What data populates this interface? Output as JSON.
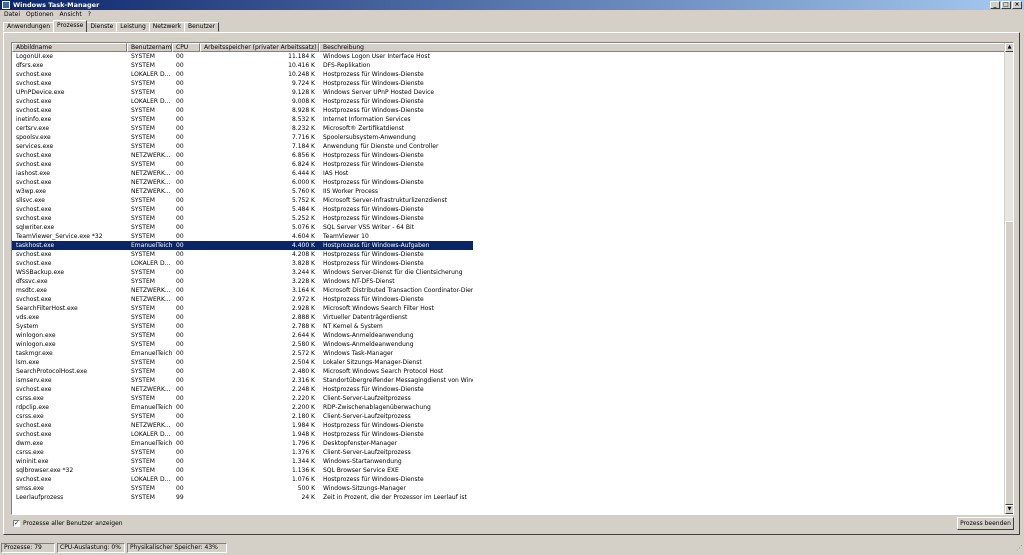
{
  "window": {
    "title": "Windows Task-Manager"
  },
  "menu": [
    "Datei",
    "Optionen",
    "Ansicht",
    "?"
  ],
  "tabs": [
    "Anwendungen",
    "Prozesse",
    "Dienste",
    "Leistung",
    "Netzwerk",
    "Benutzer"
  ],
  "active_tab": "Prozesse",
  "columns": {
    "name": "Abbildname",
    "user": "Benutzername",
    "cpu": "CPU",
    "mem": "Arbeitsspeicher (privater Arbeitssatz)",
    "desc": "Beschreibung"
  },
  "processes": [
    [
      "LogonUI.exe",
      "SYSTEM",
      "00",
      "11.184 K",
      "Windows Logon User Interface Host"
    ],
    [
      "dfsrs.exe",
      "SYSTEM",
      "00",
      "10.416 K",
      "DFS-Replikation"
    ],
    [
      "svchost.exe",
      "LOKALER D...",
      "00",
      "10.248 K",
      "Hostprozess für Windows-Dienste"
    ],
    [
      "svchost.exe",
      "SYSTEM",
      "00",
      "9.724 K",
      "Hostprozess für Windows-Dienste"
    ],
    [
      "UPnPDevice.exe",
      "SYSTEM",
      "00",
      "9.128 K",
      "Windows Server UPnP Hosted Device"
    ],
    [
      "svchost.exe",
      "LOKALER D...",
      "00",
      "9.008 K",
      "Hostprozess für Windows-Dienste"
    ],
    [
      "svchost.exe",
      "SYSTEM",
      "00",
      "8.928 K",
      "Hostprozess für Windows-Dienste"
    ],
    [
      "inetinfo.exe",
      "SYSTEM",
      "00",
      "8.532 K",
      "Internet Information Services"
    ],
    [
      "certsrv.exe",
      "SYSTEM",
      "00",
      "8.232 K",
      "Microsoft® Zertifikatdienst"
    ],
    [
      "spoolsv.exe",
      "SYSTEM",
      "00",
      "7.716 K",
      "Spoolersubsystem-Anwendung"
    ],
    [
      "services.exe",
      "SYSTEM",
      "00",
      "7.184 K",
      "Anwendung für Dienste und Controller"
    ],
    [
      "svchost.exe",
      "NETZWERK...",
      "00",
      "6.856 K",
      "Hostprozess für Windows-Dienste"
    ],
    [
      "svchost.exe",
      "SYSTEM",
      "00",
      "6.824 K",
      "Hostprozess für Windows-Dienste"
    ],
    [
      "iashost.exe",
      "NETZWERK...",
      "00",
      "6.444 K",
      "IAS Host"
    ],
    [
      "svchost.exe",
      "NETZWERK...",
      "00",
      "6.000 K",
      "Hostprozess für Windows-Dienste"
    ],
    [
      "w3wp.exe",
      "NETZWERK...",
      "00",
      "5.760 K",
      "IIS Worker Process"
    ],
    [
      "sllsvc.exe",
      "SYSTEM",
      "00",
      "5.752 K",
      "Microsoft Server-Infrastrukturlizenzdienst"
    ],
    [
      "svchost.exe",
      "SYSTEM",
      "00",
      "5.484 K",
      "Hostprozess für Windows-Dienste"
    ],
    [
      "svchost.exe",
      "SYSTEM",
      "00",
      "5.252 K",
      "Hostprozess für Windows-Dienste"
    ],
    [
      "sqlwriter.exe",
      "SYSTEM",
      "00",
      "5.076 K",
      "SQL Server VSS Writer - 64 Bit"
    ],
    [
      "TeamViewer_Service.exe *32",
      "SYSTEM",
      "00",
      "4.604 K",
      "TeamViewer 10"
    ],
    [
      "taskhost.exe",
      "EmanuelTeicht",
      "00",
      "4.400 K",
      "Hostprozess für Windows-Aufgaben"
    ],
    [
      "svchost.exe",
      "SYSTEM",
      "00",
      "4.208 K",
      "Hostprozess für Windows-Dienste"
    ],
    [
      "svchost.exe",
      "LOKALER D...",
      "00",
      "3.828 K",
      "Hostprozess für Windows-Dienste"
    ],
    [
      "WSSBackup.exe",
      "SYSTEM",
      "00",
      "3.244 K",
      "Windows Server-Dienst für die Clientsicherung"
    ],
    [
      "dfssvc.exe",
      "SYSTEM",
      "00",
      "3.228 K",
      "Windows NT-DFS-Dienst"
    ],
    [
      "msdtc.exe",
      "NETZWERK...",
      "00",
      "3.164 K",
      "Microsoft Distributed Transaction Coordinator-Dienst"
    ],
    [
      "svchost.exe",
      "NETZWERK...",
      "00",
      "2.972 K",
      "Hostprozess für Windows-Dienste"
    ],
    [
      "SearchFilterHost.exe",
      "SYSTEM",
      "00",
      "2.928 K",
      "Microsoft Windows Search Filter Host"
    ],
    [
      "vds.exe",
      "SYSTEM",
      "00",
      "2.888 K",
      "Virtueller Datenträgerdienst"
    ],
    [
      "System",
      "SYSTEM",
      "00",
      "2.788 K",
      "NT Kernel & System"
    ],
    [
      "winlogon.exe",
      "SYSTEM",
      "00",
      "2.644 K",
      "Windows-Anmeldeanwendung"
    ],
    [
      "winlogon.exe",
      "SYSTEM",
      "00",
      "2.580 K",
      "Windows-Anmeldeanwendung"
    ],
    [
      "taskmgr.exe",
      "EmanuelTeicht",
      "00",
      "2.572 K",
      "Windows Task-Manager"
    ],
    [
      "lsm.exe",
      "SYSTEM",
      "00",
      "2.504 K",
      "Lokaler Sitzungs-Manager-Dienst"
    ],
    [
      "SearchProtocolHost.exe",
      "SYSTEM",
      "00",
      "2.480 K",
      "Microsoft Windows Search Protocol Host"
    ],
    [
      "ismserv.exe",
      "SYSTEM",
      "00",
      "2.316 K",
      "Standortübergreifender Messagingdienst von Windows NT"
    ],
    [
      "svchost.exe",
      "NETZWERK...",
      "00",
      "2.248 K",
      "Hostprozess für Windows-Dienste"
    ],
    [
      "csrss.exe",
      "SYSTEM",
      "00",
      "2.220 K",
      "Client-Server-Laufzeitprozess"
    ],
    [
      "rdpclip.exe",
      "EmanuelTeicht",
      "00",
      "2.200 K",
      "RDP-Zwischenablagenüberwachung"
    ],
    [
      "csrss.exe",
      "SYSTEM",
      "00",
      "2.180 K",
      "Client-Server-Laufzeitprozess"
    ],
    [
      "svchost.exe",
      "NETZWERK...",
      "00",
      "1.984 K",
      "Hostprozess für Windows-Dienste"
    ],
    [
      "svchost.exe",
      "LOKALER D...",
      "00",
      "1.948 K",
      "Hostprozess für Windows-Dienste"
    ],
    [
      "dwm.exe",
      "EmanuelTeicht",
      "00",
      "1.796 K",
      "Desktopfenster-Manager"
    ],
    [
      "csrss.exe",
      "SYSTEM",
      "00",
      "1.376 K",
      "Client-Server-Laufzeitprozess"
    ],
    [
      "wininit.exe",
      "SYSTEM",
      "00",
      "1.344 K",
      "Windows-Startanwendung"
    ],
    [
      "sqlbrowser.exe *32",
      "SYSTEM",
      "00",
      "1.136 K",
      "SQL Browser Service EXE"
    ],
    [
      "svchost.exe",
      "LOKALER D...",
      "00",
      "1.076 K",
      "Hostprozess für Windows-Dienste"
    ],
    [
      "smss.exe",
      "SYSTEM",
      "00",
      "500 K",
      "Windows-Sitzungs-Manager"
    ],
    [
      "Leerlaufprozess",
      "SYSTEM",
      "99",
      "24 K",
      "Zeit in Prozent, die der Prozessor im Leerlauf ist"
    ]
  ],
  "selected_index": 21,
  "show_all_users_label": "Prozesse aller Benutzer anzeigen",
  "show_all_users_checked": true,
  "end_process_label": "Prozess beenden",
  "status": {
    "processes": "Prozesse: 79",
    "cpu": "CPU-Auslastung: 0%",
    "memory": "Physikalischer Speicher: 43%"
  },
  "scroll_position": 0.38,
  "colors": {
    "selection": "#0a246a",
    "titlebar": "#0a246a",
    "face": "#d4d0c8"
  }
}
